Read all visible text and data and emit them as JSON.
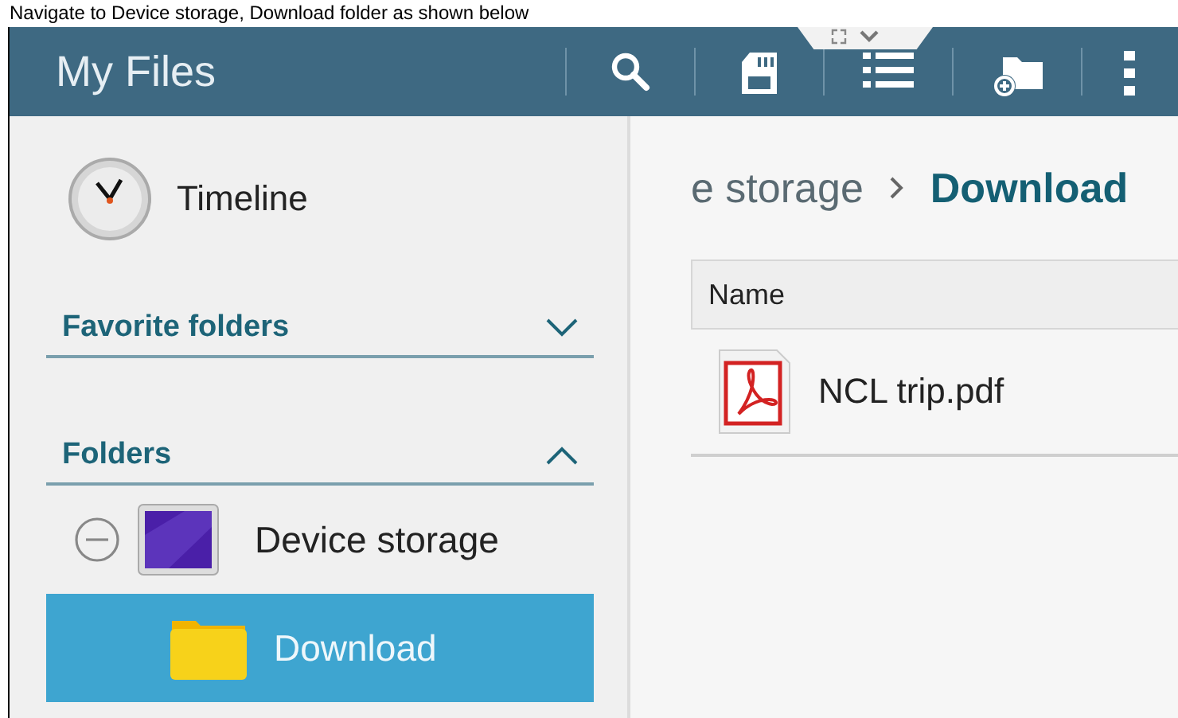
{
  "caption": "Navigate to Device storage, Download folder as shown below",
  "app_bar": {
    "title": "My Files",
    "actions": [
      {
        "kind": "search"
      },
      {
        "kind": "sd-card"
      },
      {
        "kind": "list"
      },
      {
        "kind": "new-folder"
      },
      {
        "kind": "more"
      }
    ]
  },
  "sidebar": {
    "timeline": {
      "label": "Timeline"
    },
    "sections": [
      {
        "title": "Favorite folders",
        "expanded": false
      },
      {
        "title": "Folders",
        "expanded": true,
        "items": [
          {
            "label": "Device storage",
            "expanded": true,
            "selected": false,
            "children": [
              {
                "label": "Download",
                "selected": true
              }
            ]
          }
        ]
      }
    ]
  },
  "breadcrumb": [
    {
      "label": "e storage",
      "current": false
    },
    {
      "label": "Download",
      "current": true
    }
  ],
  "table": {
    "columns": [
      "Name"
    ],
    "rows": [
      {
        "name": "NCL trip.pdf"
      }
    ]
  }
}
